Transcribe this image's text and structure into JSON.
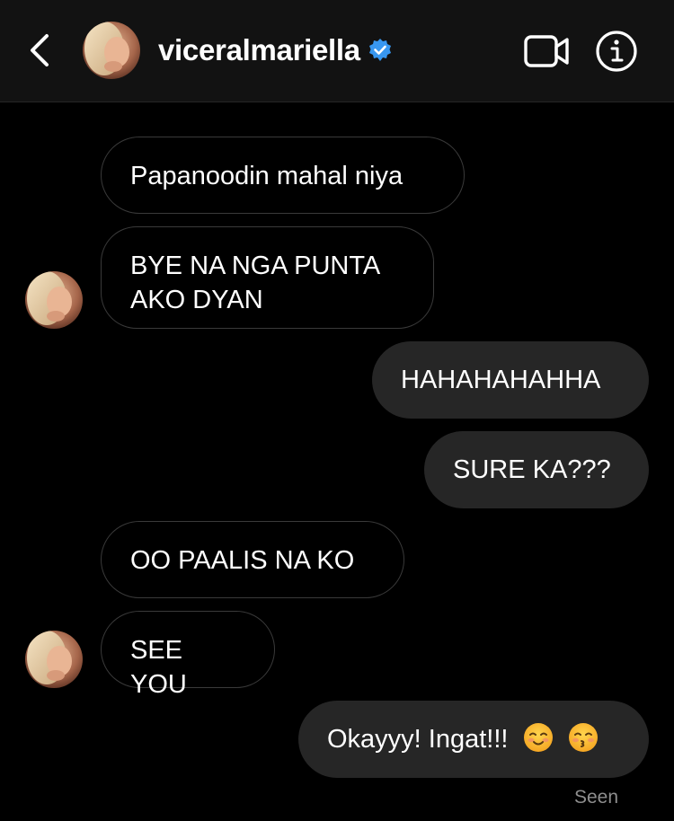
{
  "header": {
    "username": "viceralmariella",
    "verified": true,
    "back_icon": "chevron-left-icon",
    "video_icon": "video-camera-icon",
    "info_icon": "info-icon"
  },
  "messages": [
    {
      "sender": "them",
      "text": "Papanoodin mahal niya"
    },
    {
      "sender": "them",
      "text": "BYE NA NGA PUNTA\nAKO DYAN"
    },
    {
      "sender": "me",
      "text": "HAHAHAHAHHA"
    },
    {
      "sender": "me",
      "text": "SURE KA???"
    },
    {
      "sender": "them",
      "text": "OO PAALIS NA KO"
    },
    {
      "sender": "them",
      "text": "SEE YOU"
    },
    {
      "sender": "me",
      "text": "Okayyy! Ingat!!!",
      "emojis": [
        "smiling-face-icon",
        "kissing-face-icon"
      ]
    }
  ],
  "status": {
    "seen_label": "Seen"
  },
  "colors": {
    "background": "#000000",
    "header_bg": "#121212",
    "incoming_border": "#3a3a3a",
    "outgoing_bg": "#262626",
    "verified_blue": "#3897f0",
    "muted_text": "#8e8e8e"
  }
}
